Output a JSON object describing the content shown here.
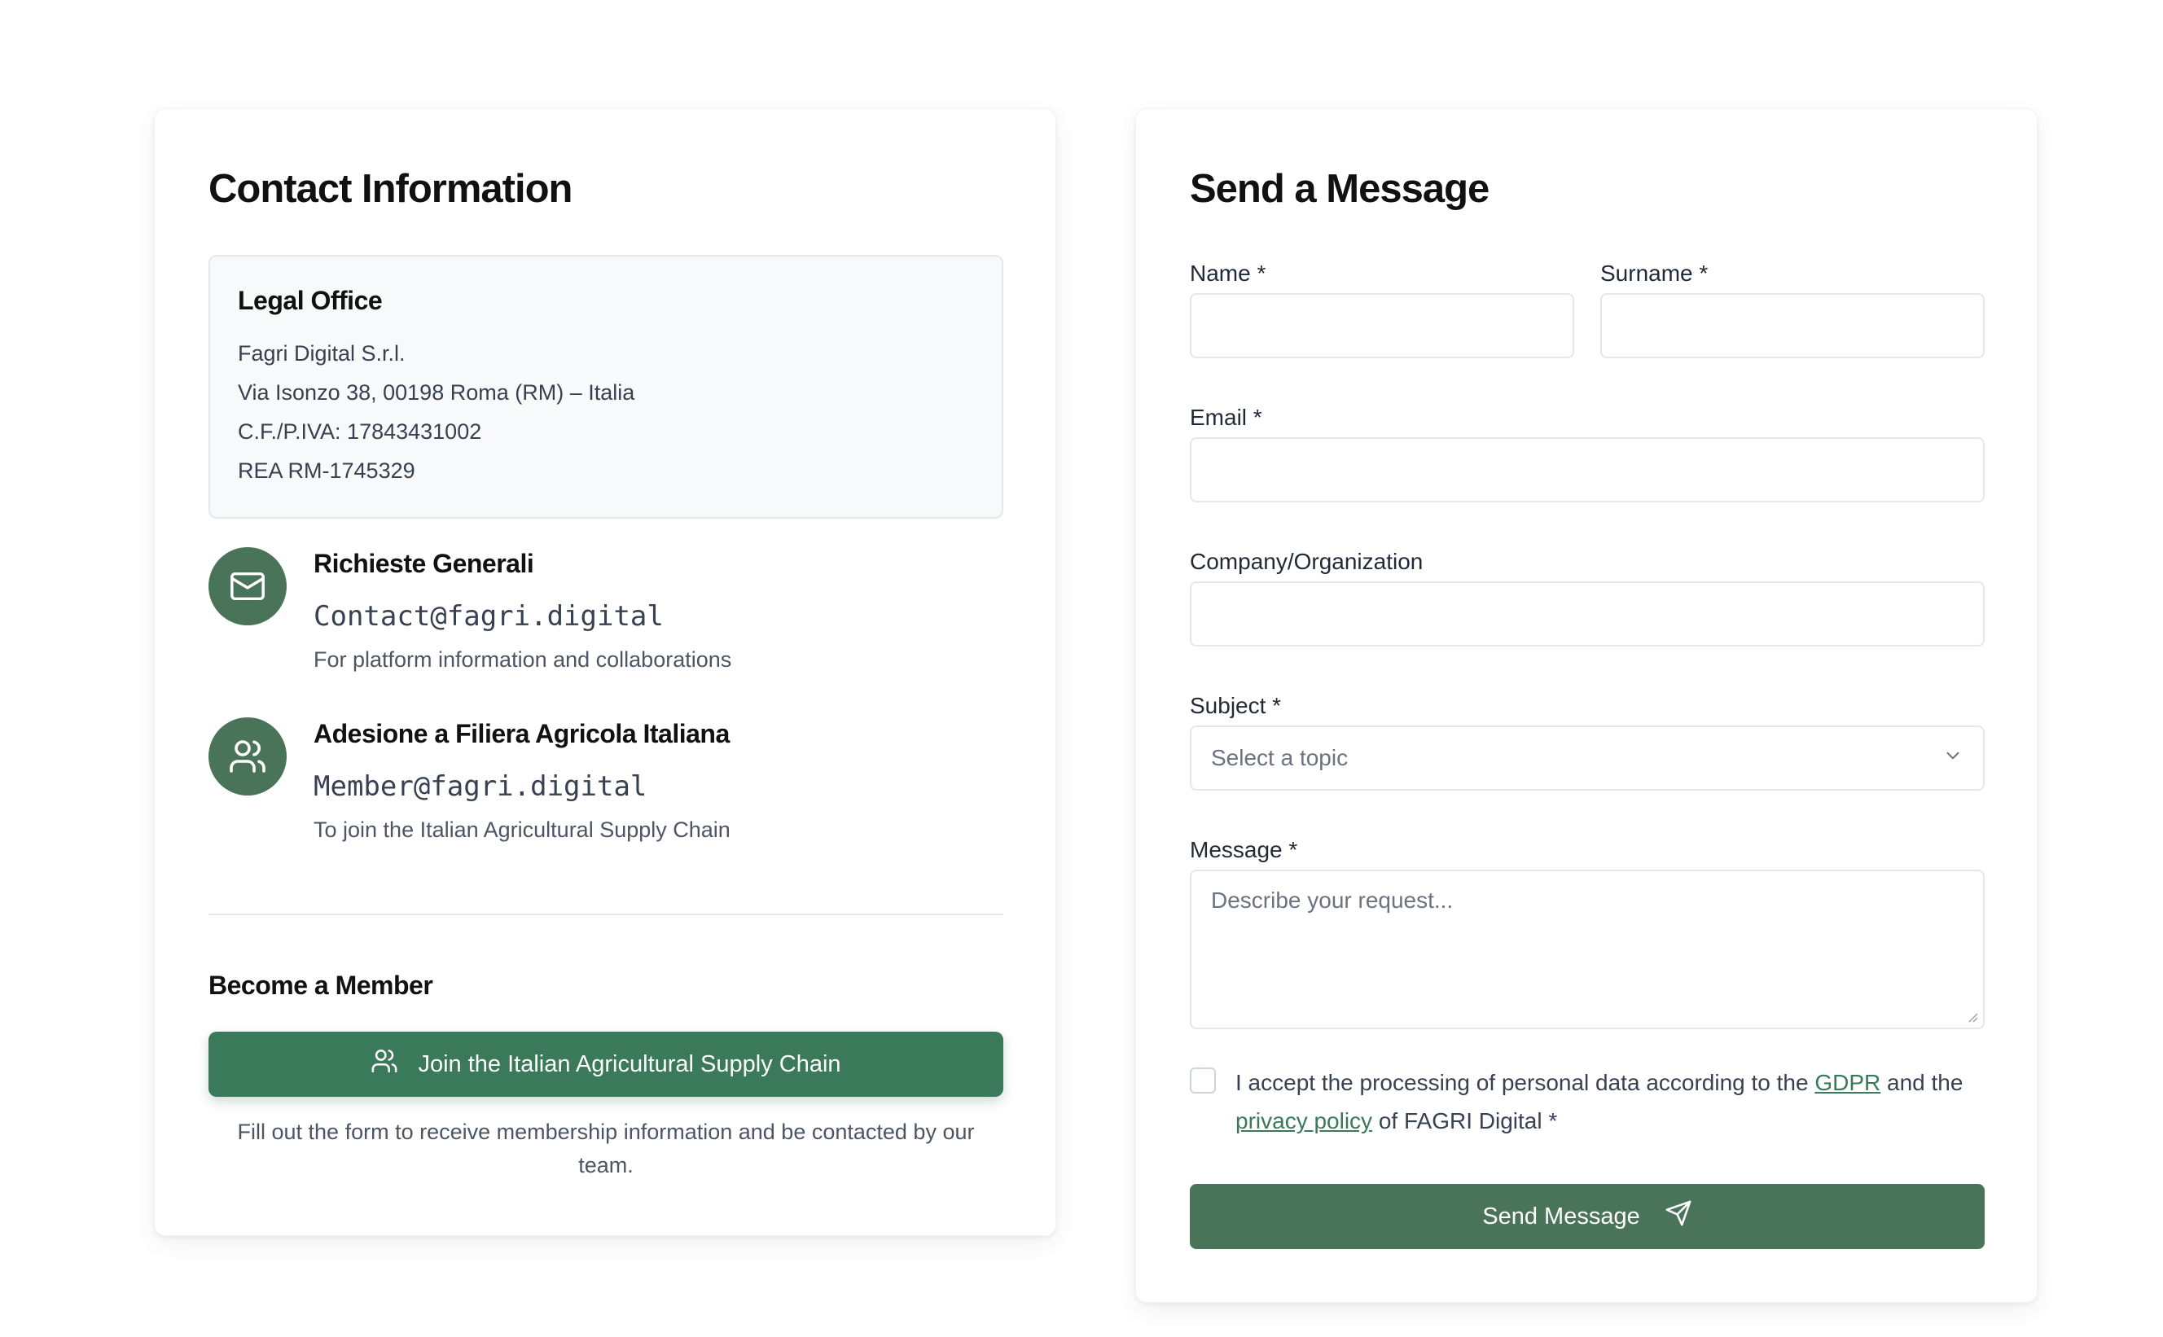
{
  "contact": {
    "title": "Contact Information",
    "legal_office": {
      "title": "Legal Office",
      "lines": [
        "Fagri Digital S.r.l.",
        "Via Isonzo 38, 00198 Roma (RM) – Italia",
        "C.F./P.IVA: 17843431002",
        "REA RM-1745329"
      ]
    },
    "items": [
      {
        "icon": "mail-icon",
        "title": "Richieste Generali",
        "email": "Contact@fagri.digital",
        "description": "For platform information and collaborations"
      },
      {
        "icon": "users-icon",
        "title": "Adesione a Filiera Agricola Italiana",
        "email": "Member@fagri.digital",
        "description": "To join the Italian Agricultural Supply Chain"
      }
    ],
    "member": {
      "title": "Become a Member",
      "button_label": "Join the Italian Agricultural Supply Chain",
      "note": "Fill out the form to receive membership information and be contacted by our team."
    }
  },
  "form": {
    "title": "Send a Message",
    "name_label": "Name *",
    "name_value": "",
    "surname_label": "Surname *",
    "surname_value": "",
    "email_label": "Email *",
    "email_value": "",
    "company_label": "Company/Organization",
    "company_value": "",
    "subject_label": "Subject *",
    "subject_selected": "Select a topic",
    "message_label": "Message *",
    "message_placeholder": "Describe your request...",
    "consent": {
      "before": "I accept the processing of personal data according to the ",
      "gdpr_link": "GDPR",
      "middle": " and the ",
      "privacy_link": "privacy policy",
      "after": " of FAGRI Digital *"
    },
    "submit_label": "Send Message"
  },
  "colors": {
    "accent": "#3a7959",
    "icon_bg": "#4a7459",
    "submit_bg": "#4a7459"
  }
}
